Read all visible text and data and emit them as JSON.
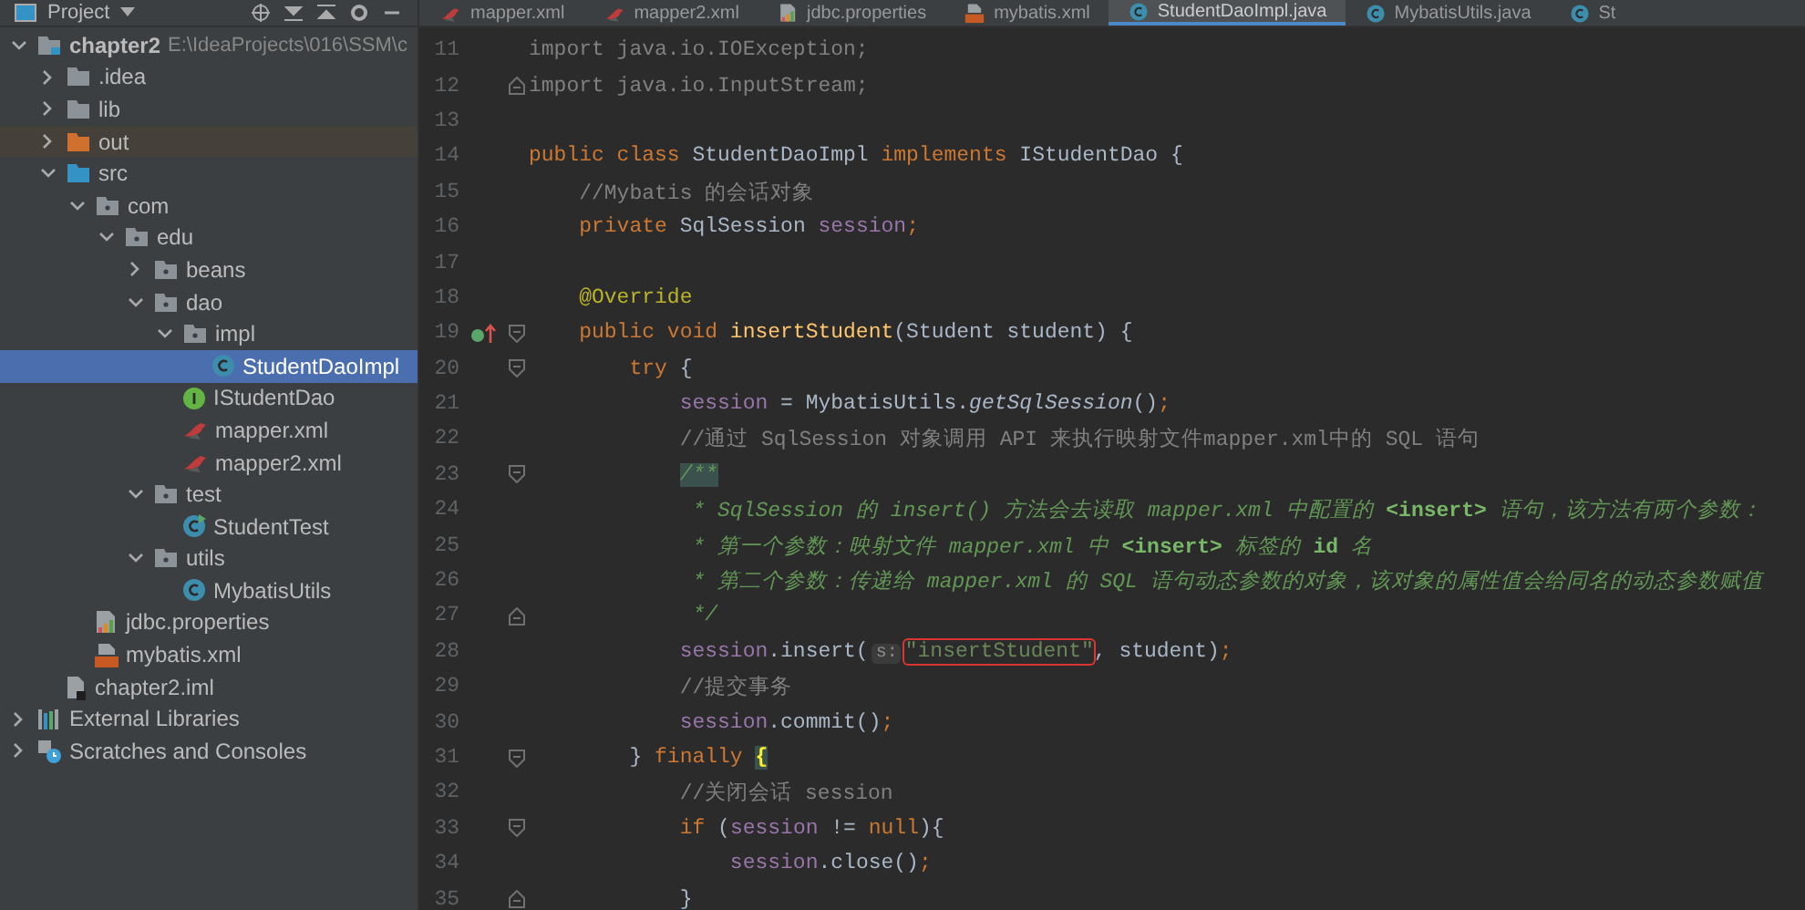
{
  "project_panel": {
    "title": "Project",
    "tree": [
      {
        "label": "chapter2",
        "detail": "E:\\IdeaProjects\\016\\SSM\\c",
        "kind": "module",
        "expanded": true,
        "selected": false,
        "children": [
          {
            "label": ".idea",
            "kind": "folder",
            "expanded": false,
            "selected": false
          },
          {
            "label": "lib",
            "kind": "folder",
            "expanded": false,
            "selected": false
          },
          {
            "label": "out",
            "kind": "excluded",
            "expanded": false,
            "selected": false
          },
          {
            "label": "src",
            "kind": "source",
            "expanded": true,
            "selected": false,
            "children": [
              {
                "label": "com",
                "kind": "package",
                "expanded": true,
                "selected": false,
                "children": [
                  {
                    "label": "edu",
                    "kind": "package",
                    "expanded": true,
                    "selected": false,
                    "children": [
                      {
                        "label": "beans",
                        "kind": "package",
                        "expanded": false,
                        "selected": false
                      },
                      {
                        "label": "dao",
                        "kind": "package",
                        "expanded": true,
                        "selected": false,
                        "children": [
                          {
                            "label": "impl",
                            "kind": "package",
                            "expanded": true,
                            "selected": false,
                            "children": [
                              {
                                "label": "StudentDaoImpl",
                                "kind": "class",
                                "selected": true
                              }
                            ]
                          },
                          {
                            "label": "IStudentDao",
                            "kind": "interface",
                            "selected": false
                          },
                          {
                            "label": "mapper.xml",
                            "kind": "xml",
                            "selected": false
                          },
                          {
                            "label": "mapper2.xml",
                            "kind": "xml",
                            "selected": false
                          }
                        ]
                      },
                      {
                        "label": "test",
                        "kind": "package",
                        "expanded": true,
                        "selected": false,
                        "children": [
                          {
                            "label": "StudentTest",
                            "kind": "testclass",
                            "selected": false
                          }
                        ]
                      },
                      {
                        "label": "utils",
                        "kind": "package",
                        "expanded": true,
                        "selected": false,
                        "children": [
                          {
                            "label": "MybatisUtils",
                            "kind": "class",
                            "selected": false
                          }
                        ]
                      }
                    ]
                  }
                ]
              },
              {
                "label": "jdbc.properties",
                "kind": "properties",
                "selected": false
              },
              {
                "label": "mybatis.xml",
                "kind": "config",
                "selected": false
              }
            ]
          },
          {
            "label": "chapter2.iml",
            "kind": "iml",
            "selected": false
          }
        ]
      },
      {
        "label": "External Libraries",
        "kind": "libraries",
        "expanded": false,
        "selected": false
      },
      {
        "label": "Scratches and Consoles",
        "kind": "scratches",
        "expanded": false,
        "selected": false
      }
    ]
  },
  "editor_tabs": [
    {
      "label": "mapper.xml",
      "kind": "xml",
      "selected": false
    },
    {
      "label": "mapper2.xml",
      "kind": "xml",
      "selected": false
    },
    {
      "label": "jdbc.properties",
      "kind": "properties",
      "selected": false
    },
    {
      "label": "mybatis.xml",
      "kind": "config",
      "selected": false
    },
    {
      "label": "StudentDaoImpl.java",
      "kind": "class",
      "selected": true
    },
    {
      "label": "MybatisUtils.java",
      "kind": "class",
      "selected": false
    },
    {
      "label": "St",
      "kind": "class",
      "selected": false
    }
  ],
  "code_lines": [
    {
      "number": "11",
      "override_marker": false,
      "fold_start": false,
      "fold_end": false,
      "tokens": [
        {
          "text": "import java.io.IOException;",
          "kind": "comment"
        }
      ]
    },
    {
      "number": "12",
      "override_marker": false,
      "fold_start": false,
      "fold_end": true,
      "tokens": [
        {
          "text": "import java.io.InputStream;",
          "kind": "comment"
        }
      ]
    },
    {
      "number": "13",
      "override_marker": false,
      "fold_start": false,
      "fold_end": false
    },
    {
      "number": "14",
      "override_marker": false,
      "fold_start": false,
      "fold_end": false,
      "tokens": [
        {
          "text": "public class ",
          "kind": "kw"
        },
        {
          "text": "StudentDaoImpl ",
          "kind": "plain"
        },
        {
          "text": "implements ",
          "kind": "kw"
        },
        {
          "text": "IStudentDao {",
          "kind": "plain"
        }
      ]
    },
    {
      "number": "15",
      "override_marker": false,
      "fold_start": false,
      "fold_end": false,
      "tokens": [
        {
          "text": "    //Mybatis 的会话对象",
          "kind": "comment"
        }
      ]
    },
    {
      "number": "16",
      "override_marker": false,
      "fold_start": false,
      "fold_end": false,
      "tokens": [
        {
          "text": "    private ",
          "kind": "kw"
        },
        {
          "text": "SqlSession ",
          "kind": "plain"
        },
        {
          "text": "session",
          "kind": "field"
        },
        {
          "text": ";",
          "kind": "kw"
        }
      ]
    },
    {
      "number": "17",
      "override_marker": false,
      "fold_start": false,
      "fold_end": false
    },
    {
      "number": "18",
      "override_marker": false,
      "fold_start": false,
      "fold_end": false,
      "tokens": [
        {
          "text": "    @Override",
          "kind": "annot"
        }
      ]
    },
    {
      "number": "19",
      "override_marker": true,
      "fold_start": true,
      "fold_end": false,
      "tokens": [
        {
          "text": "    public void ",
          "kind": "kw"
        },
        {
          "text": "insertStudent",
          "kind": "method"
        },
        {
          "text": "(Student student) {",
          "kind": "plain"
        }
      ]
    },
    {
      "number": "20",
      "override_marker": false,
      "fold_start": true,
      "fold_end": false,
      "tokens": [
        {
          "text": "        try ",
          "kind": "kw"
        },
        {
          "text": "{",
          "kind": "plain"
        }
      ]
    },
    {
      "number": "21",
      "override_marker": false,
      "fold_start": false,
      "fold_end": false,
      "tokens": [
        {
          "text": "            session",
          "kind": "field"
        },
        {
          "text": " = MybatisUtils.",
          "kind": "plain"
        },
        {
          "text": "getSqlSession",
          "kind": "static"
        },
        {
          "text": "()",
          "kind": "plain"
        },
        {
          "text": ";",
          "kind": "kw"
        }
      ]
    },
    {
      "number": "22",
      "override_marker": false,
      "fold_start": false,
      "fold_end": false,
      "tokens": [
        {
          "text": "            //通过 SqlSession 对象调用 API 来执行映射文件mapper.xml中的 SQL 语句",
          "kind": "comment"
        }
      ]
    },
    {
      "number": "23",
      "override_marker": false,
      "fold_start": true,
      "fold_end": false,
      "tokens": [
        {
          "text": "            /**",
          "kind": "doc-match"
        }
      ]
    },
    {
      "number": "24",
      "override_marker": false,
      "fold_start": false,
      "fold_end": false,
      "tokens": [
        {
          "text": "             * SqlSession 的 insert() 方法会去读取 mapper.xml 中配置的 ",
          "kind": "doc"
        },
        {
          "text": "<insert>",
          "kind": "doctag"
        },
        {
          "text": " 语句，该方法有两个参数：",
          "kind": "doc"
        }
      ]
    },
    {
      "number": "25",
      "override_marker": false,
      "fold_start": false,
      "fold_end": false,
      "tokens": [
        {
          "text": "             * 第一个参数：映射文件 mapper.xml 中 ",
          "kind": "doc"
        },
        {
          "text": "<insert>",
          "kind": "doctag"
        },
        {
          "text": " 标签的 ",
          "kind": "doc"
        },
        {
          "text": "id",
          "kind": "doctag"
        },
        {
          "text": " 名",
          "kind": "doc"
        }
      ]
    },
    {
      "number": "26",
      "override_marker": false,
      "fold_start": false,
      "fold_end": false,
      "tokens": [
        {
          "text": "             * 第二个参数：传递给 mapper.xml 的 SQL 语句动态参数的对象，该对象的属性值会给同名的动态参数赋值",
          "kind": "doc"
        }
      ]
    },
    {
      "number": "27",
      "override_marker": false,
      "fold_start": false,
      "fold_end": true,
      "tokens": [
        {
          "text": "             */",
          "kind": "doc"
        }
      ]
    },
    {
      "number": "28",
      "override_marker": false,
      "fold_start": false,
      "fold_end": false,
      "tokens": [
        {
          "text": "            session",
          "kind": "field"
        },
        {
          "text": ".insert(",
          "kind": "plain"
        },
        {
          "text": "s:",
          "kind": "hint"
        },
        {
          "text": "\"insertStudent\"",
          "kind": "boxed"
        },
        {
          "text": ", student)",
          "kind": "plain"
        },
        {
          "text": ";",
          "kind": "kw"
        }
      ]
    },
    {
      "number": "29",
      "override_marker": false,
      "fold_start": false,
      "fold_end": false,
      "tokens": [
        {
          "text": "            //提交事务",
          "kind": "comment"
        }
      ]
    },
    {
      "number": "30",
      "override_marker": false,
      "fold_start": false,
      "fold_end": false,
      "tokens": [
        {
          "text": "            session",
          "kind": "field"
        },
        {
          "text": ".commit()",
          "kind": "plain"
        },
        {
          "text": ";",
          "kind": "kw"
        }
      ]
    },
    {
      "number": "31",
      "override_marker": false,
      "fold_start": true,
      "fold_end": false,
      "tokens": [
        {
          "text": "        } ",
          "kind": "plain"
        },
        {
          "text": "finally ",
          "kind": "kw"
        },
        {
          "text": "{",
          "kind": "brace-match"
        }
      ]
    },
    {
      "number": "32",
      "override_marker": false,
      "fold_start": false,
      "fold_end": false,
      "tokens": [
        {
          "text": "            //关闭会话 session",
          "kind": "comment"
        }
      ]
    },
    {
      "number": "33",
      "override_marker": false,
      "fold_start": true,
      "fold_end": false,
      "tokens": [
        {
          "text": "            if ",
          "kind": "kw"
        },
        {
          "text": "(",
          "kind": "plain"
        },
        {
          "text": "session",
          "kind": "field"
        },
        {
          "text": " != ",
          "kind": "plain"
        },
        {
          "text": "null",
          "kind": "kw"
        },
        {
          "text": "){",
          "kind": "plain"
        }
      ]
    },
    {
      "number": "34",
      "override_marker": false,
      "fold_start": false,
      "fold_end": false,
      "tokens": [
        {
          "text": "                session",
          "kind": "field"
        },
        {
          "text": ".close()",
          "kind": "plain"
        },
        {
          "text": ";",
          "kind": "kw"
        }
      ]
    },
    {
      "number": "35",
      "override_marker": false,
      "fold_start": false,
      "fold_end": true,
      "tokens": [
        {
          "text": "            }",
          "kind": "plain"
        }
      ]
    }
  ]
}
